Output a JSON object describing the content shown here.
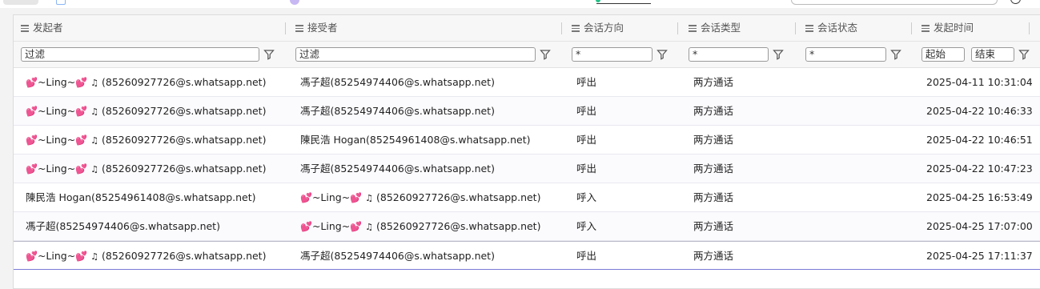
{
  "columns": [
    {
      "label": "发起者",
      "filter_placeholder": "过滤"
    },
    {
      "label": "接受者",
      "filter_placeholder": "过滤"
    },
    {
      "label": "会话方向",
      "filter_value": "*"
    },
    {
      "label": "会话类型",
      "filter_value": "*"
    },
    {
      "label": "会话状态",
      "filter_value": "*"
    },
    {
      "label": "发起时间",
      "filter_start": "起始",
      "filter_end": "结束"
    }
  ],
  "icons": {
    "column_menu": "hamburger-lines-icon",
    "filter": "funnel-filter-icon",
    "heart": "two-hearts-emoji",
    "music": "musical-notes-emoji"
  },
  "colors": {
    "heart": "#e8336f",
    "selected_row_border": "#7a7ad6"
  },
  "rows": [
    {
      "caller_name": "~Ling~",
      "caller_id": "(85260927726@s.whatsapp.net)",
      "callee": "馮子超(85254974406@s.whatsapp.net)",
      "direction": "呼出",
      "type": "两方通话",
      "status": "",
      "time": "2025-04-11 10:31:04"
    },
    {
      "caller_name": "~Ling~",
      "caller_id": "(85260927726@s.whatsapp.net)",
      "callee": "馮子超(85254974406@s.whatsapp.net)",
      "direction": "呼出",
      "type": "两方通话",
      "status": "",
      "time": "2025-04-22 10:46:33"
    },
    {
      "caller_name": "~Ling~",
      "caller_id": "(85260927726@s.whatsapp.net)",
      "callee": "陳民浩 Hogan(85254961408@s.whatsapp.net)",
      "direction": "呼出",
      "type": "两方通话",
      "status": "",
      "time": "2025-04-22 10:46:51"
    },
    {
      "caller_name": "~Ling~",
      "caller_id": "(85260927726@s.whatsapp.net)",
      "callee": "馮子超(85254974406@s.whatsapp.net)",
      "direction": "呼出",
      "type": "两方通话",
      "status": "",
      "time": "2025-04-22 10:47:23"
    },
    {
      "caller": "陳民浩 Hogan(85254961408@s.whatsapp.net)",
      "callee_name": "~Ling~",
      "callee_id": "(85260927726@s.whatsapp.net)",
      "direction": "呼入",
      "type": "两方通话",
      "status": "",
      "time": "2025-04-25 16:53:49"
    },
    {
      "caller": "馮子超(85254974406@s.whatsapp.net)",
      "callee_name": "~Ling~",
      "callee_id": "(85260927726@s.whatsapp.net)",
      "direction": "呼入",
      "type": "两方通话",
      "status": "",
      "time": "2025-04-25 17:07:00"
    },
    {
      "caller_name": "~Ling~",
      "caller_id": "(85260927726@s.whatsapp.net)",
      "callee": "馮子超(85254974406@s.whatsapp.net)",
      "direction": "呼出",
      "type": "两方通话",
      "status": "",
      "time": "2025-04-25 17:11:37"
    }
  ]
}
